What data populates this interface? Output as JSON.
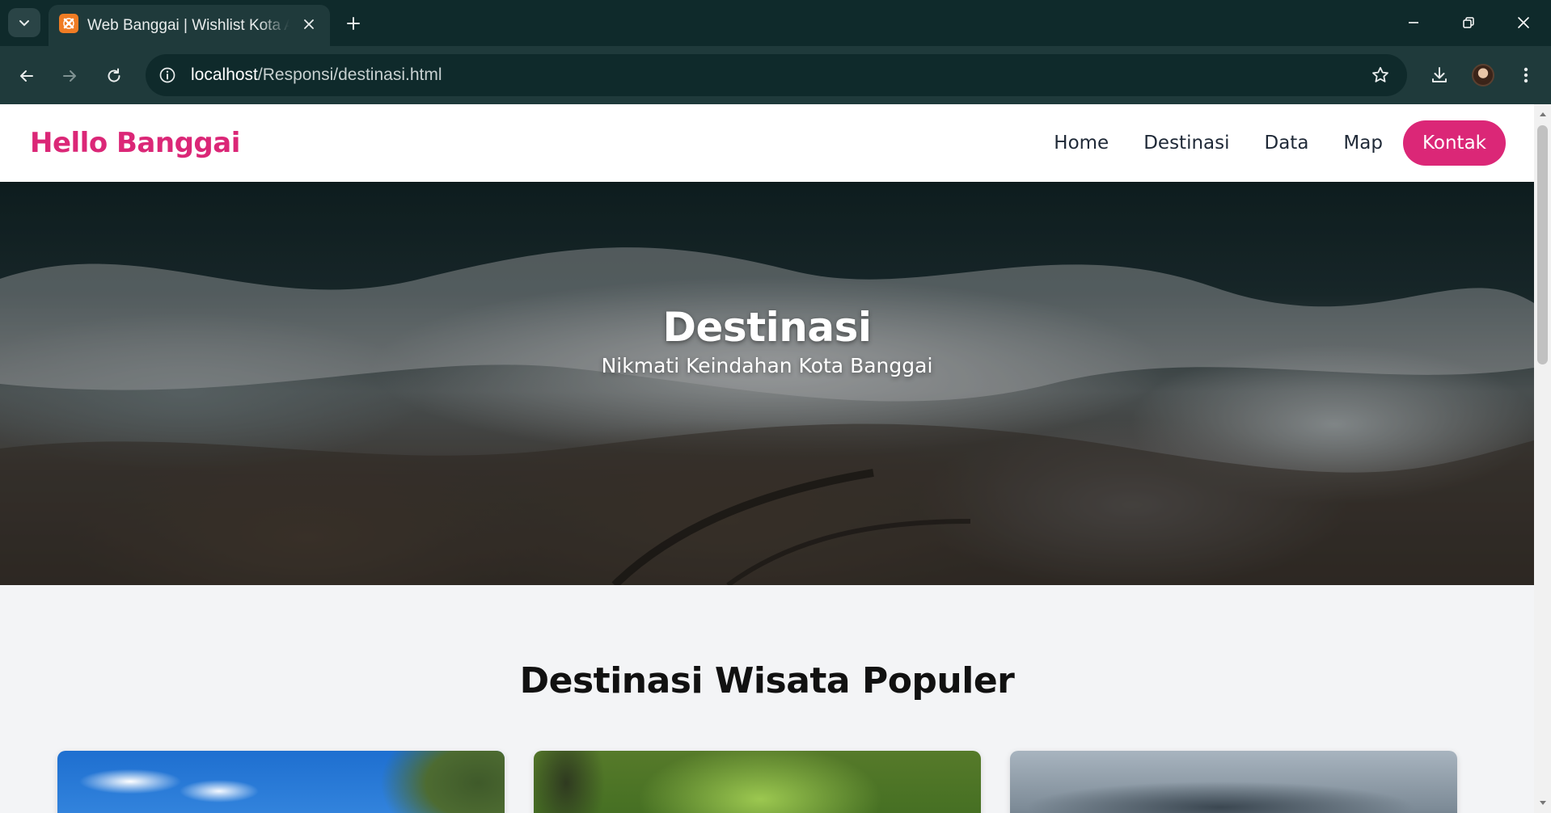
{
  "browser": {
    "tab_title": "Web Banggai | Wishlist Kota Am",
    "url_host": "localhost",
    "url_path": "/Responsi/destinasi.html"
  },
  "site": {
    "brand": "Hello Banggai",
    "nav": [
      {
        "label": "Home"
      },
      {
        "label": "Destinasi"
      },
      {
        "label": "Data"
      },
      {
        "label": "Map"
      }
    ],
    "cta_label": "Kontak",
    "accent_color": "#db2777"
  },
  "hero": {
    "title": "Destinasi",
    "subtitle": "Nikmati Keindahan Kota Banggai"
  },
  "destinations": {
    "section_title": "Destinasi Wisata Populer"
  },
  "icons": {
    "tab_menu": "chevron-down-icon",
    "favicon": "xampp-icon",
    "tab_close": "close-icon",
    "new_tab": "plus-icon",
    "minimize": "minimize-icon",
    "restore": "restore-icon",
    "close_window": "close-icon",
    "back": "arrow-left-icon",
    "forward": "arrow-right-icon",
    "reload": "reload-icon",
    "site_info": "info-icon",
    "bookmark": "star-icon",
    "downloads": "download-icon",
    "profile": "avatar",
    "menu": "more-vertical-icon"
  }
}
